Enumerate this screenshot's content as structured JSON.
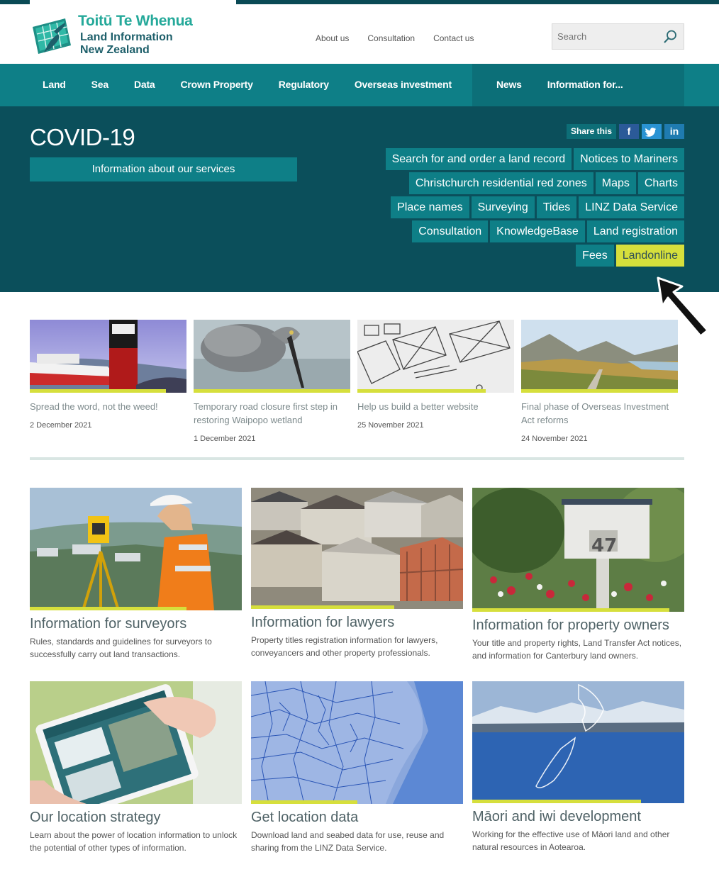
{
  "brand": {
    "name_line1": "Toitū Te Whenua",
    "name_line2": "Land Information",
    "name_line3": "New Zealand"
  },
  "toplinks": [
    "About us",
    "Consultation",
    "Contact us"
  ],
  "search": {
    "placeholder": "Search",
    "icon": "search-icon"
  },
  "nav": {
    "left": [
      "Land",
      "Sea",
      "Data",
      "Crown Property",
      "Regulatory",
      "Overseas investment"
    ],
    "right": [
      "News",
      "Information for..."
    ]
  },
  "hero": {
    "title": "COVID-19",
    "button": "Information about our services",
    "share_label": "Share this",
    "share_icons": [
      "facebook-icon",
      "twitter-icon",
      "linkedin-icon"
    ],
    "quicklinks": [
      [
        "Search for and order a land record",
        "Notices to Mariners"
      ],
      [
        "Christchurch residential red zones",
        "Maps",
        "Charts"
      ],
      [
        "Place names",
        "Surveying",
        "Tides",
        "LINZ Data Service"
      ],
      [
        "Consultation",
        "KnowledgeBase",
        "Land registration"
      ],
      [
        "Fees",
        "Landonline"
      ]
    ],
    "highlighted": "Landonline"
  },
  "news": [
    {
      "title": "Spread the word, not the weed!",
      "date": "2 December 2021"
    },
    {
      "title": "Temporary road closure first step in restoring Waipopo wetland",
      "date": "1 December 2021"
    },
    {
      "title": "Help us build a better website",
      "date": "25 November 2021"
    },
    {
      "title": "Final phase of Overseas Investment Act reforms",
      "date": "24 November 2021"
    }
  ],
  "features": [
    {
      "title": "Information for surveyors",
      "desc": "Rules, standards and guidelines for surveyors to successfully carry out land transactions."
    },
    {
      "title": "Information for lawyers",
      "desc": "Property titles registration information for lawyers, conveyancers and other property professionals."
    },
    {
      "title": "Information for property owners",
      "desc": "Your title and property rights, Land Transfer Act notices, and information for Canterbury land owners."
    },
    {
      "title": "Our location strategy",
      "desc": "Learn about the power of location information to unlock the potential of other types of information."
    },
    {
      "title": "Get location data",
      "desc": "Download land and seabed data for use, reuse and sharing from the LINZ Data Service."
    },
    {
      "title": "Māori and iwi development",
      "desc": "Working for the effective use of Māori land and other natural resources in Aotearoa."
    }
  ],
  "colors": {
    "teal": "#0e7f87",
    "dark_teal": "#0b4f5b",
    "accent_yellow": "#d6df3c",
    "logo_green": "#25a99a"
  }
}
